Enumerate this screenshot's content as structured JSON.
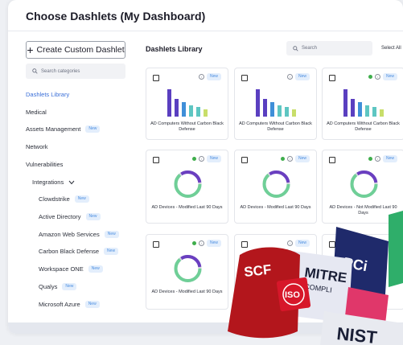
{
  "dialog": {
    "title": "Choose Dashlets (My Dashboard)"
  },
  "sidebar": {
    "create_label": "Create Custom Dashlet",
    "search_placeholder": "Search categories",
    "items": [
      {
        "label": "Dashlets Library",
        "active": true
      },
      {
        "label": "Medical"
      },
      {
        "label": "Assets Management",
        "badge": "New"
      },
      {
        "label": "Network"
      },
      {
        "label": "Vulnerabilities"
      },
      {
        "label": "Integrations"
      },
      {
        "label": "Clowdstrike",
        "badge": "New"
      },
      {
        "label": "Active Directory",
        "badge": "New"
      },
      {
        "label": "Amazon Web Services",
        "badge": "New"
      },
      {
        "label": "Carbon Black Defense",
        "badge": "New"
      },
      {
        "label": "Workspace ONE",
        "badge": "New"
      },
      {
        "label": "Qualys",
        "badge": "New"
      },
      {
        "label": "Microsoft Azure",
        "badge": "New"
      }
    ]
  },
  "library": {
    "title": "Dashlets Library",
    "search_placeholder": "Search",
    "select_all": "Select All",
    "cards": [
      {
        "type": "bars",
        "badge": "New",
        "caption": "AD Computers Without Carbon Black Defense"
      },
      {
        "type": "bars",
        "badge": "New",
        "caption": "AD Computers Without Carbon Black Defense"
      },
      {
        "type": "bars",
        "badge": "New",
        "caption": "AD Computers Without Carbon Black Defense"
      },
      {
        "type": "donut",
        "badge": "New",
        "caption": "AD Devices - Modified Last 90 Days"
      },
      {
        "type": "donut",
        "badge": "New",
        "caption": "AD Devices - Modified Last 90 Days"
      },
      {
        "type": "donut",
        "badge": "New",
        "caption": "AD Devices - Not Modified Last 90 Days"
      },
      {
        "type": "donut",
        "badge": "New",
        "caption": "AD Devices - Modified Last 90 Days"
      },
      {
        "type": "none",
        "badge": "New",
        "caption": ""
      },
      {
        "type": "none",
        "badge": "",
        "caption": ""
      }
    ]
  },
  "compliance_badges": {
    "scf": "SCF",
    "mitre": "MITRE",
    "mitre_sub": "COMPLI",
    "pci": "PCi",
    "iso": "ISO",
    "nist": "NIST"
  },
  "colors": {
    "accent": "#3a6fd8",
    "bar_purple": "#5a3fc0",
    "bar_blue": "#3f8fd8",
    "bar_teal": "#5ec6c2",
    "bar_lime": "#c8de6a",
    "donut_green": "#6fcf97",
    "donut_purple": "#6a3fc0",
    "status_green": "#3fae4c"
  }
}
